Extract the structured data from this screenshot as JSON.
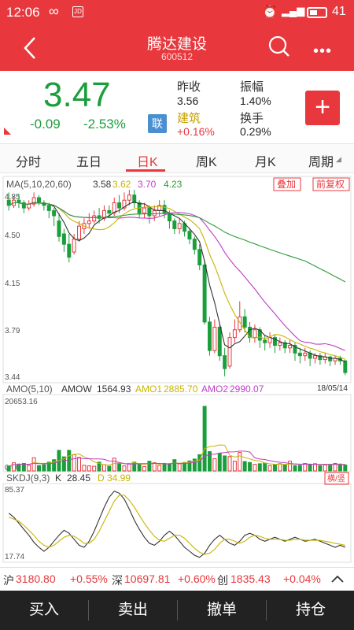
{
  "status": {
    "time": "12:06",
    "battery": "41"
  },
  "header": {
    "title": "腾达建设",
    "code": "600512"
  },
  "quote": {
    "price": "3.47",
    "change": "-0.09",
    "change_pct": "-2.53%",
    "lian": "联",
    "prev_close_label": "昨收",
    "prev_close": "3.56",
    "sector_label": "建筑",
    "sector_change": "+0.16%",
    "amplitude_label": "振幅",
    "amplitude": "1.40%",
    "turnover_label": "换手",
    "turnover": "0.29%",
    "add_label": "+"
  },
  "tabs": [
    "分时",
    "五日",
    "日K",
    "周K",
    "月K",
    "周期"
  ],
  "active_tab": 2,
  "ma_legend": {
    "label": "MA(5,10,20,60)",
    "values": [
      "3.58",
      "3.62",
      "3.70",
      "4.23"
    ],
    "colors": [
      "#333333",
      "#c8b400",
      "#c03cc8",
      "#2e9b3a"
    ],
    "overlay": "叠加",
    "adjust": "前复权"
  },
  "amo_legend": {
    "label": "AMO(5,10)",
    "amow_label": "AMOW",
    "amow": "1564.93",
    "amo1_label": "AMO1",
    "amo1": "2885.70",
    "amo2_label": "AMO2",
    "amo2": "2990.07"
  },
  "skdj_legend": {
    "label": "SKDJ(9,3)",
    "k_label": "K",
    "k": "28.45",
    "d_label": "D",
    "d": "34.99",
    "toggle": "横/竖"
  },
  "colors": {
    "up": "#e8383d",
    "down": "#1b9e3c",
    "brand": "#e8383d"
  },
  "chart_data": {
    "type": "candlestick",
    "price_axis": {
      "ticks": [
        "4.85",
        "4.50",
        "4.15",
        "3.79",
        "3.44"
      ],
      "range": [
        3.44,
        4.85
      ]
    },
    "date_label": "18/05/14",
    "candles": [
      {
        "o": 4.8,
        "c": 4.76,
        "h": 4.86,
        "l": 4.72
      },
      {
        "o": 4.76,
        "c": 4.8,
        "h": 4.83,
        "l": 4.74
      },
      {
        "o": 4.8,
        "c": 4.78,
        "h": 4.85,
        "l": 4.74
      },
      {
        "o": 4.78,
        "c": 4.74,
        "h": 4.8,
        "l": 4.7
      },
      {
        "o": 4.74,
        "c": 4.77,
        "h": 4.8,
        "l": 4.72
      },
      {
        "o": 4.77,
        "c": 4.82,
        "h": 4.86,
        "l": 4.75
      },
      {
        "o": 4.82,
        "c": 4.78,
        "h": 4.84,
        "l": 4.76
      },
      {
        "o": 4.78,
        "c": 4.76,
        "h": 4.8,
        "l": 4.72
      },
      {
        "o": 4.76,
        "c": 4.72,
        "h": 4.78,
        "l": 4.66
      },
      {
        "o": 4.72,
        "c": 4.68,
        "h": 4.74,
        "l": 4.6
      },
      {
        "o": 4.64,
        "c": 4.52,
        "h": 4.7,
        "l": 4.48
      },
      {
        "o": 4.54,
        "c": 4.46,
        "h": 4.58,
        "l": 4.4
      },
      {
        "o": 4.46,
        "c": 4.36,
        "h": 4.54,
        "l": 4.32
      },
      {
        "o": 4.4,
        "c": 4.5,
        "h": 4.54,
        "l": 4.38
      },
      {
        "o": 4.5,
        "c": 4.6,
        "h": 4.64,
        "l": 4.48
      },
      {
        "o": 4.58,
        "c": 4.62,
        "h": 4.66,
        "l": 4.54
      },
      {
        "o": 4.62,
        "c": 4.64,
        "h": 4.7,
        "l": 4.58
      },
      {
        "o": 4.64,
        "c": 4.68,
        "h": 4.72,
        "l": 4.62
      },
      {
        "o": 4.68,
        "c": 4.66,
        "h": 4.74,
        "l": 4.62
      },
      {
        "o": 4.66,
        "c": 4.72,
        "h": 4.76,
        "l": 4.64
      },
      {
        "o": 4.72,
        "c": 4.7,
        "h": 4.76,
        "l": 4.66
      },
      {
        "o": 4.7,
        "c": 4.78,
        "h": 4.82,
        "l": 4.68
      },
      {
        "o": 4.78,
        "c": 4.74,
        "h": 4.84,
        "l": 4.7
      },
      {
        "o": 4.74,
        "c": 4.8,
        "h": 4.86,
        "l": 4.72
      },
      {
        "o": 4.8,
        "c": 4.84,
        "h": 4.88,
        "l": 4.76
      },
      {
        "o": 4.84,
        "c": 4.78,
        "h": 4.88,
        "l": 4.74
      },
      {
        "o": 4.78,
        "c": 4.7,
        "h": 4.8,
        "l": 4.66
      },
      {
        "o": 4.7,
        "c": 4.74,
        "h": 4.78,
        "l": 4.66
      },
      {
        "o": 4.74,
        "c": 4.68,
        "h": 4.76,
        "l": 4.62
      },
      {
        "o": 4.68,
        "c": 4.72,
        "h": 4.76,
        "l": 4.64
      },
      {
        "o": 4.72,
        "c": 4.76,
        "h": 4.8,
        "l": 4.68
      },
      {
        "o": 4.76,
        "c": 4.7,
        "h": 4.8,
        "l": 4.66
      },
      {
        "o": 4.7,
        "c": 4.64,
        "h": 4.72,
        "l": 4.58
      },
      {
        "o": 4.64,
        "c": 4.58,
        "h": 4.66,
        "l": 4.54
      },
      {
        "o": 4.58,
        "c": 4.62,
        "h": 4.66,
        "l": 4.54
      },
      {
        "o": 4.62,
        "c": 4.56,
        "h": 4.64,
        "l": 4.52
      },
      {
        "o": 4.56,
        "c": 4.5,
        "h": 4.58,
        "l": 4.46
      },
      {
        "o": 4.5,
        "c": 4.42,
        "h": 4.52,
        "l": 4.38
      },
      {
        "o": 4.42,
        "c": 4.3,
        "h": 4.46,
        "l": 4.26
      },
      {
        "o": 4.3,
        "c": 3.86,
        "h": 4.34,
        "l": 3.84
      },
      {
        "o": 3.86,
        "c": 3.64,
        "h": 3.9,
        "l": 3.6
      },
      {
        "o": 3.64,
        "c": 3.82,
        "h": 3.88,
        "l": 3.62
      },
      {
        "o": 3.82,
        "c": 3.6,
        "h": 3.84,
        "l": 3.56
      },
      {
        "o": 3.6,
        "c": 3.5,
        "h": 3.66,
        "l": 3.44
      },
      {
        "o": 3.52,
        "c": 3.74,
        "h": 3.78,
        "l": 3.5
      },
      {
        "o": 3.74,
        "c": 3.8,
        "h": 3.88,
        "l": 3.7
      },
      {
        "o": 3.8,
        "c": 3.9,
        "h": 4.02,
        "l": 3.78
      },
      {
        "o": 3.9,
        "c": 3.82,
        "h": 3.96,
        "l": 3.78
      },
      {
        "o": 3.82,
        "c": 3.74,
        "h": 3.86,
        "l": 3.7
      },
      {
        "o": 3.74,
        "c": 3.8,
        "h": 3.84,
        "l": 3.7
      },
      {
        "o": 3.8,
        "c": 3.72,
        "h": 3.82,
        "l": 3.66
      },
      {
        "o": 3.72,
        "c": 3.7,
        "h": 3.76,
        "l": 3.64
      },
      {
        "o": 3.7,
        "c": 3.74,
        "h": 3.78,
        "l": 3.66
      },
      {
        "o": 3.74,
        "c": 3.68,
        "h": 3.76,
        "l": 3.62
      },
      {
        "o": 3.68,
        "c": 3.7,
        "h": 3.74,
        "l": 3.64
      },
      {
        "o": 3.7,
        "c": 3.66,
        "h": 3.72,
        "l": 3.62
      },
      {
        "o": 3.66,
        "c": 3.68,
        "h": 3.72,
        "l": 3.62
      },
      {
        "o": 3.68,
        "c": 3.62,
        "h": 3.7,
        "l": 3.56
      },
      {
        "o": 3.62,
        "c": 3.6,
        "h": 3.66,
        "l": 3.54
      },
      {
        "o": 3.6,
        "c": 3.62,
        "h": 3.66,
        "l": 3.56
      },
      {
        "o": 3.62,
        "c": 3.58,
        "h": 3.64,
        "l": 3.52
      },
      {
        "o": 3.58,
        "c": 3.6,
        "h": 3.62,
        "l": 3.54
      },
      {
        "o": 3.6,
        "c": 3.57,
        "h": 3.62,
        "l": 3.53
      },
      {
        "o": 3.57,
        "c": 3.59,
        "h": 3.62,
        "l": 3.54
      },
      {
        "o": 3.59,
        "c": 3.56,
        "h": 3.6,
        "l": 3.52
      },
      {
        "o": 3.56,
        "c": 3.58,
        "h": 3.6,
        "l": 3.53
      },
      {
        "o": 3.58,
        "c": 3.56,
        "h": 3.6,
        "l": 3.53
      },
      {
        "o": 3.56,
        "c": 3.47,
        "h": 3.57,
        "l": 3.45
      }
    ],
    "volume_axis": {
      "max_label": "20653.16",
      "min_label": "0.00",
      "max": 20653.16
    },
    "volumes": [
      1500,
      2600,
      2200,
      2400,
      1800,
      4200,
      1700,
      2000,
      2800,
      3600,
      6600,
      4500,
      6600,
      5200,
      4300,
      1800,
      1600,
      1500,
      2800,
      2000,
      1500,
      4100,
      2300,
      1600,
      2400,
      2800,
      2200,
      1400,
      3100,
      2600,
      1800,
      2400,
      2100,
      3600,
      2300,
      2700,
      3200,
      3800,
      5200,
      20653,
      6200,
      3900,
      5600,
      4800,
      4600,
      3100,
      5900,
      3000,
      2700,
      2100,
      2300,
      2500,
      1700,
      2000,
      2300,
      1900,
      3100,
      1700,
      1800,
      2400,
      2000,
      2300,
      1700,
      1900,
      2100,
      2400,
      2200,
      1900
    ],
    "skdj_axis": {
      "max_label": "85.37",
      "min_label": "17.74",
      "range": [
        17.74,
        85.37
      ]
    },
    "skdj_k": [
      62,
      58,
      52,
      46,
      40,
      33,
      28,
      24,
      28,
      34,
      40,
      45,
      42,
      36,
      30,
      28,
      34,
      44,
      56,
      68,
      78,
      84,
      82,
      76,
      66,
      55,
      46,
      38,
      32,
      30,
      34,
      40,
      44,
      40,
      34,
      28,
      24,
      20,
      18,
      22,
      30,
      36,
      40,
      36,
      32,
      30,
      34,
      40,
      42,
      40,
      36,
      34,
      36,
      38,
      36,
      34,
      36,
      38,
      36,
      34,
      35,
      36,
      34,
      32,
      30,
      28,
      30,
      28
    ],
    "skdj_d": [
      58,
      56,
      54,
      50,
      45,
      40,
      34,
      30,
      28,
      30,
      34,
      38,
      40,
      39,
      36,
      32,
      32,
      36,
      44,
      54,
      64,
      74,
      80,
      80,
      75,
      68,
      60,
      52,
      45,
      39,
      35,
      34,
      37,
      40,
      40,
      37,
      32,
      27,
      23,
      21,
      22,
      26,
      32,
      36,
      36,
      34,
      32,
      34,
      38,
      40,
      39,
      37,
      36,
      36,
      36,
      35,
      35,
      36,
      36,
      35,
      35,
      35,
      35,
      34,
      33,
      32,
      31,
      30
    ]
  },
  "ticker": {
    "sh_label": "沪",
    "sh": "3180.80",
    "sh_pct": "+0.55%",
    "sz_label": "深",
    "sz": "10697.81",
    "sz_pct": "+0.60%",
    "cy_label": "创",
    "cy": "1835.43",
    "cy_pct": "+0.04%"
  },
  "actions": [
    "买入",
    "卖出",
    "撤单",
    "持仓"
  ]
}
